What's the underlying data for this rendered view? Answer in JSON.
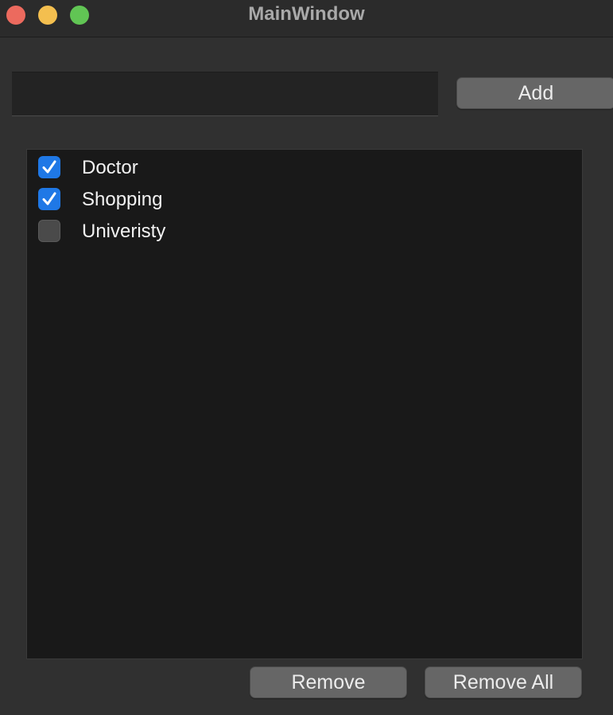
{
  "window": {
    "title": "MainWindow",
    "traffic_lights": [
      "close",
      "minimize",
      "maximize"
    ]
  },
  "input": {
    "value": "",
    "placeholder": ""
  },
  "buttons": {
    "add_label": "Add",
    "remove_label": "Remove",
    "remove_all_label": "Remove All"
  },
  "todo_list": {
    "items": [
      {
        "label": "Doctor",
        "checked": true
      },
      {
        "label": "Shopping",
        "checked": true
      },
      {
        "label": "Univeristy",
        "checked": false
      }
    ]
  },
  "colors": {
    "accent": "#1f78e6",
    "close": "#ec6a5e",
    "minimize": "#f4bf4f",
    "maximize": "#61c554"
  },
  "icons": {
    "checkmark": "checkmark-icon"
  }
}
